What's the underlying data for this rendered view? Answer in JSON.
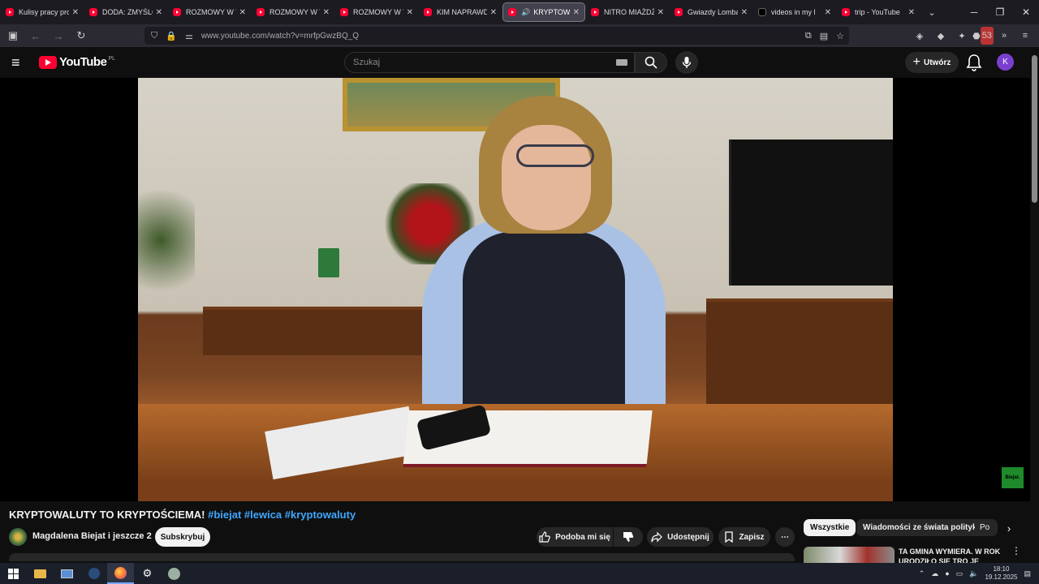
{
  "browser": {
    "tabs": [
      {
        "title": "Kulisy pracy prosty",
        "icon": "youtube-favicon"
      },
      {
        "title": "DODA: ZMYŚLONE",
        "icon": "youtube-favicon"
      },
      {
        "title": "ROZMOWY W TOK",
        "icon": "youtube-favicon"
      },
      {
        "title": "ROZMOWY W TOK",
        "icon": "youtube-favicon"
      },
      {
        "title": "ROZMOWY W TOK",
        "icon": "youtube-favicon"
      },
      {
        "title": "KIM NAPRAWDĘ JE",
        "icon": "youtube-favicon"
      },
      {
        "title": "KRYPTOWALU",
        "icon": "youtube-favicon",
        "active": true,
        "audio": true
      },
      {
        "title": "NITRO MIAŻDŻY N",
        "icon": "youtube-favicon"
      },
      {
        "title": "Gwiazdy Lombard",
        "icon": "youtube-favicon"
      },
      {
        "title": "videos in my l",
        "icon": "x-favicon"
      },
      {
        "title": "trip - YouTube",
        "icon": "youtube-favicon"
      }
    ],
    "url": "www.youtube.com/watch?v=mrfpGwzBQ_Q",
    "extension_badge": "53"
  },
  "youtube": {
    "logo_text": "YouTube",
    "region": "PL",
    "search_placeholder": "Szukaj",
    "create_label": "Utwórz",
    "avatar_letter": "K"
  },
  "video": {
    "title_main": "KRYPTOWALUTY TO KRYPTOŚCIEMA!",
    "title_tags": "#biejat #lewica #kryptowaluty",
    "channel": "Magdalena Biejat i jeszcze 2",
    "subscribe_label": "Subskrybuj",
    "like_label": "Podoba mi się",
    "share_label": "Udostępnij",
    "save_label": "Zapisz",
    "watermark_text": "Biejat."
  },
  "sidebar": {
    "chips": [
      "Wszystkie",
      "Wiadomości ze świata polityki",
      "Po"
    ],
    "recommendation_title": "TA GMINA WYMIERA. W ROK URODZIŁO SIĘ TRO JE DZIECI"
  },
  "taskbar": {
    "time": "18:10",
    "date": "19.12.2025"
  },
  "colors": {
    "youtube_red": "#ff0033",
    "link_blue": "#3ea6ff",
    "bg": "#0f0f0f"
  }
}
